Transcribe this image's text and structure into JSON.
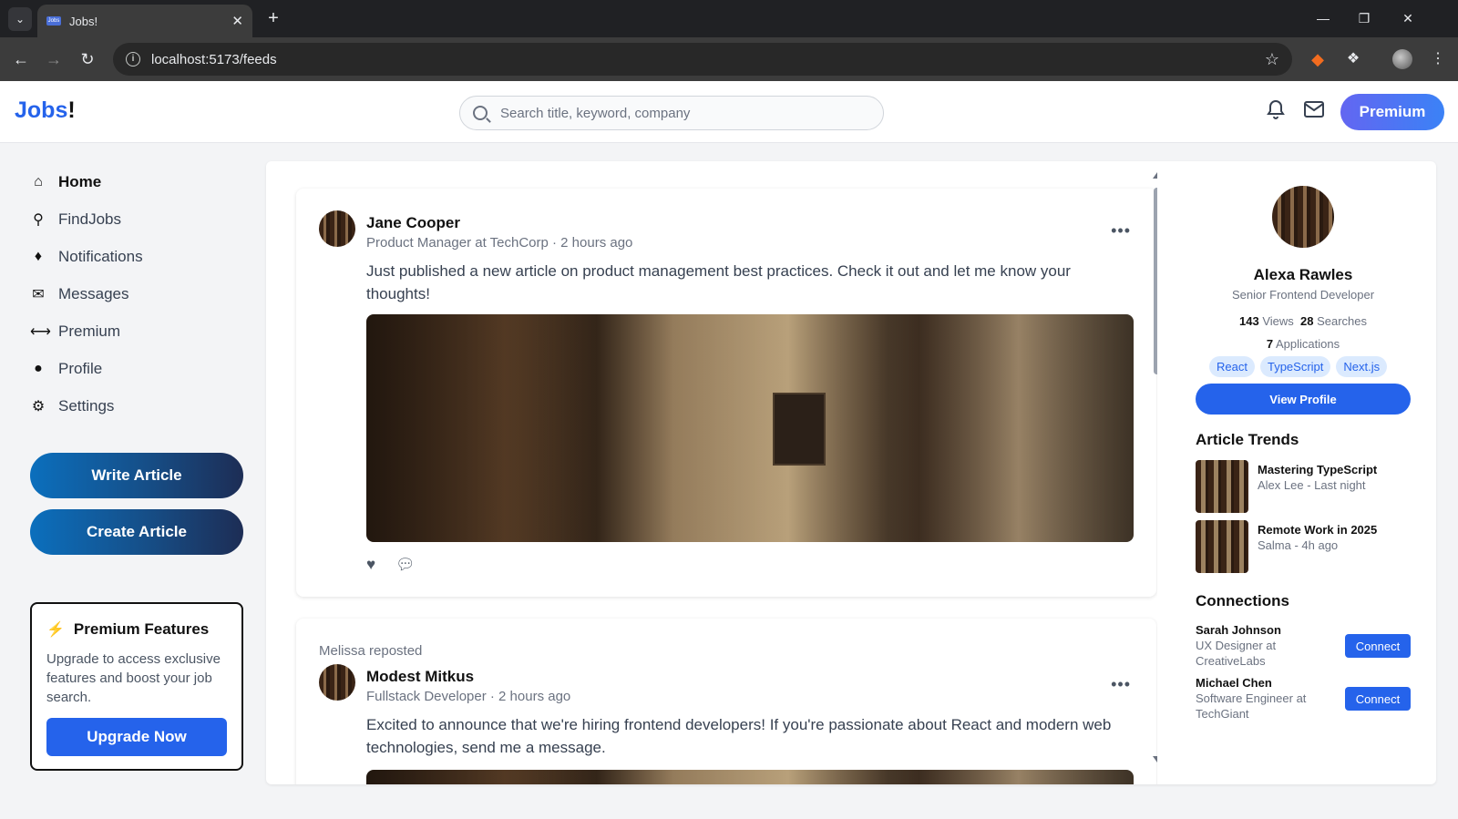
{
  "browser": {
    "tab_title": "Jobs!",
    "tab_favicon_text": "Jobs",
    "url": "localhost:5173/feeds"
  },
  "header": {
    "logo_text": "Jobs",
    "logo_bang": "!",
    "search_placeholder": "Search title, keyword, company",
    "premium_label": "Premium"
  },
  "sidebar": {
    "items": [
      {
        "label": "Home",
        "icon": "home-icon"
      },
      {
        "label": "FindJobs",
        "icon": "search-icon"
      },
      {
        "label": "Notifications",
        "icon": "bell-icon"
      },
      {
        "label": "Messages",
        "icon": "envelope-icon"
      },
      {
        "label": "Premium",
        "icon": "bolt-icon"
      },
      {
        "label": "Profile",
        "icon": "user-icon"
      },
      {
        "label": "Settings",
        "icon": "gear-icon"
      }
    ],
    "write_article": "Write Article",
    "create_article": "Create Article",
    "premium_card": {
      "title": "Premium Features",
      "description": "Upgrade to access exclusive features and boost your job search.",
      "button": "Upgrade Now"
    }
  },
  "feed": {
    "posts": [
      {
        "author": "Jane Cooper",
        "meta": "Product Manager at TechCorp · 2 hours ago",
        "text": "Just published a new article on product management best practices. Check it out and let me know your thoughts!"
      },
      {
        "reposted_by": "Melissa reposted",
        "author": "Modest Mitkus",
        "meta": "Fullstack Developer · 2 hours ago",
        "text": "Excited to announce that we're hiring frontend developers! If you're passionate about React and modern web technologies, send me a message."
      }
    ]
  },
  "profile": {
    "name": "Alexa Rawles",
    "role": "Senior Frontend Developer",
    "views_count": "143",
    "views_label": "Views",
    "searches_count": "28",
    "searches_label": "Searches",
    "applications_count": "7",
    "applications_label": "Applications",
    "skills": [
      "React",
      "TypeScript",
      "Next.js"
    ],
    "view_button": "View Profile"
  },
  "article_trends": {
    "title": "Article Trends",
    "items": [
      {
        "title": "Mastering TypeScript",
        "meta": "Alex Lee - Last night"
      },
      {
        "title": "Remote Work in 2025",
        "meta": "Salma - 4h ago"
      }
    ]
  },
  "connections": {
    "title": "Connections",
    "items": [
      {
        "name": "Sarah Johnson",
        "role": "UX Designer at CreativeLabs",
        "button": "Connect"
      },
      {
        "name": "Michael Chen",
        "role": "Software Engineer at TechGiant",
        "button": "Connect"
      }
    ]
  },
  "colors": {
    "accent": "#2563eb",
    "premium_gradient_start": "#6366f1",
    "premium_gradient_end": "#3b82f6",
    "bolt": "#f97316"
  }
}
